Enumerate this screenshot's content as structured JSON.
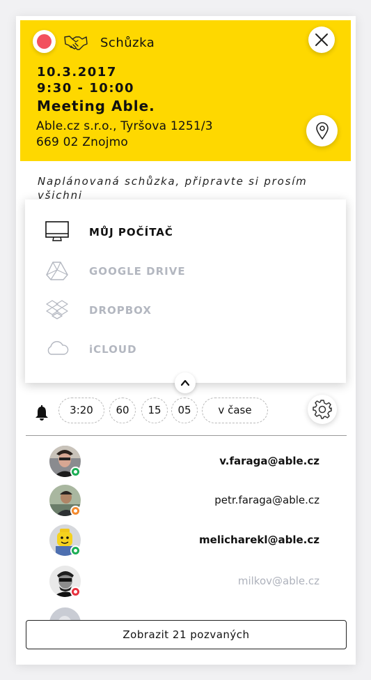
{
  "meeting": {
    "type": "Schůzka",
    "date": "10.3.2017",
    "time": "9:30 - 10:00",
    "title": "Meeting Able.",
    "address_line1": "Able.cz s.r.o., Tyršova 1251/3",
    "address_line2": "669 02 Znojmo",
    "note": "Naplánovaná schůzka, připravte si prosím všichni",
    "header_color": "#fed800",
    "record_color": "#f2515e"
  },
  "storage_picker": {
    "items": [
      {
        "label": "MŮJ POČÍTAČ",
        "icon": "monitor-icon",
        "active": true
      },
      {
        "label": "GOOGLE DRIVE",
        "icon": "google-drive-icon",
        "active": false
      },
      {
        "label": "DROPBOX",
        "icon": "dropbox-icon",
        "active": false
      },
      {
        "label": "iCLOUD",
        "icon": "icloud-icon",
        "active": false
      }
    ]
  },
  "reminders": {
    "icon": "bell-icon",
    "chips": [
      "3:20",
      "60",
      "15",
      "05",
      "v čase"
    ]
  },
  "invitees": [
    {
      "email": "v.faraga@able.cz",
      "status": "online",
      "status_color": "#1cae55",
      "bold": true
    },
    {
      "email": "petr.faraga@able.cz",
      "status": "away",
      "status_color": "#f48a2e",
      "bold": false
    },
    {
      "email": "melicharekl@able.cz",
      "status": "online",
      "status_color": "#1cae55",
      "bold": true
    },
    {
      "email": "milkov@able.cz",
      "status": "offline",
      "status_color": "#e8323f",
      "bold": false
    }
  ],
  "show_invited_label": "Zobrazit 21 pozvaných"
}
